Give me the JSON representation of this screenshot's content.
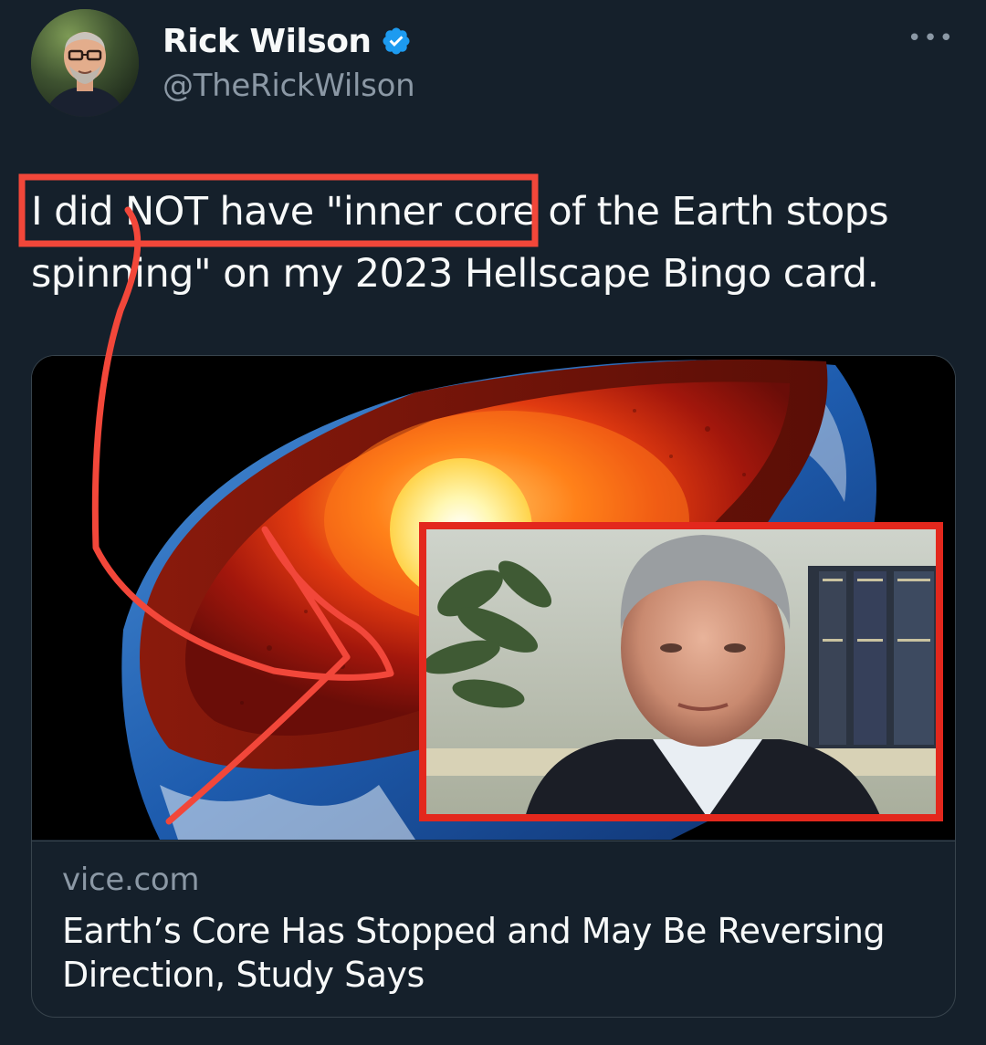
{
  "author": {
    "display_name": "Rick Wilson",
    "handle": "@TheRickWilson",
    "verified": true,
    "avatar_icon": "avatar"
  },
  "more_menu": {
    "label": "•••",
    "icon": "more-dots-icon"
  },
  "tweet": {
    "text_line_1": "I did NOT have \"inner core of the Earth stops",
    "text_line_2": "spinning\" on my 2023 Hellscape Bingo card."
  },
  "link_card": {
    "domain": "vice.com",
    "title": "Earth’s Core Has Stopped and May Be Reversing Direction, Study Says",
    "image_description_icon": "earth-core-image"
  },
  "colors": {
    "background": "#15202b",
    "text_primary": "#f7f9f9",
    "text_secondary": "#8b98a5",
    "verified_blue": "#1d9bf0",
    "annotation_red": "#f2473a",
    "card_border": "#38444d"
  }
}
